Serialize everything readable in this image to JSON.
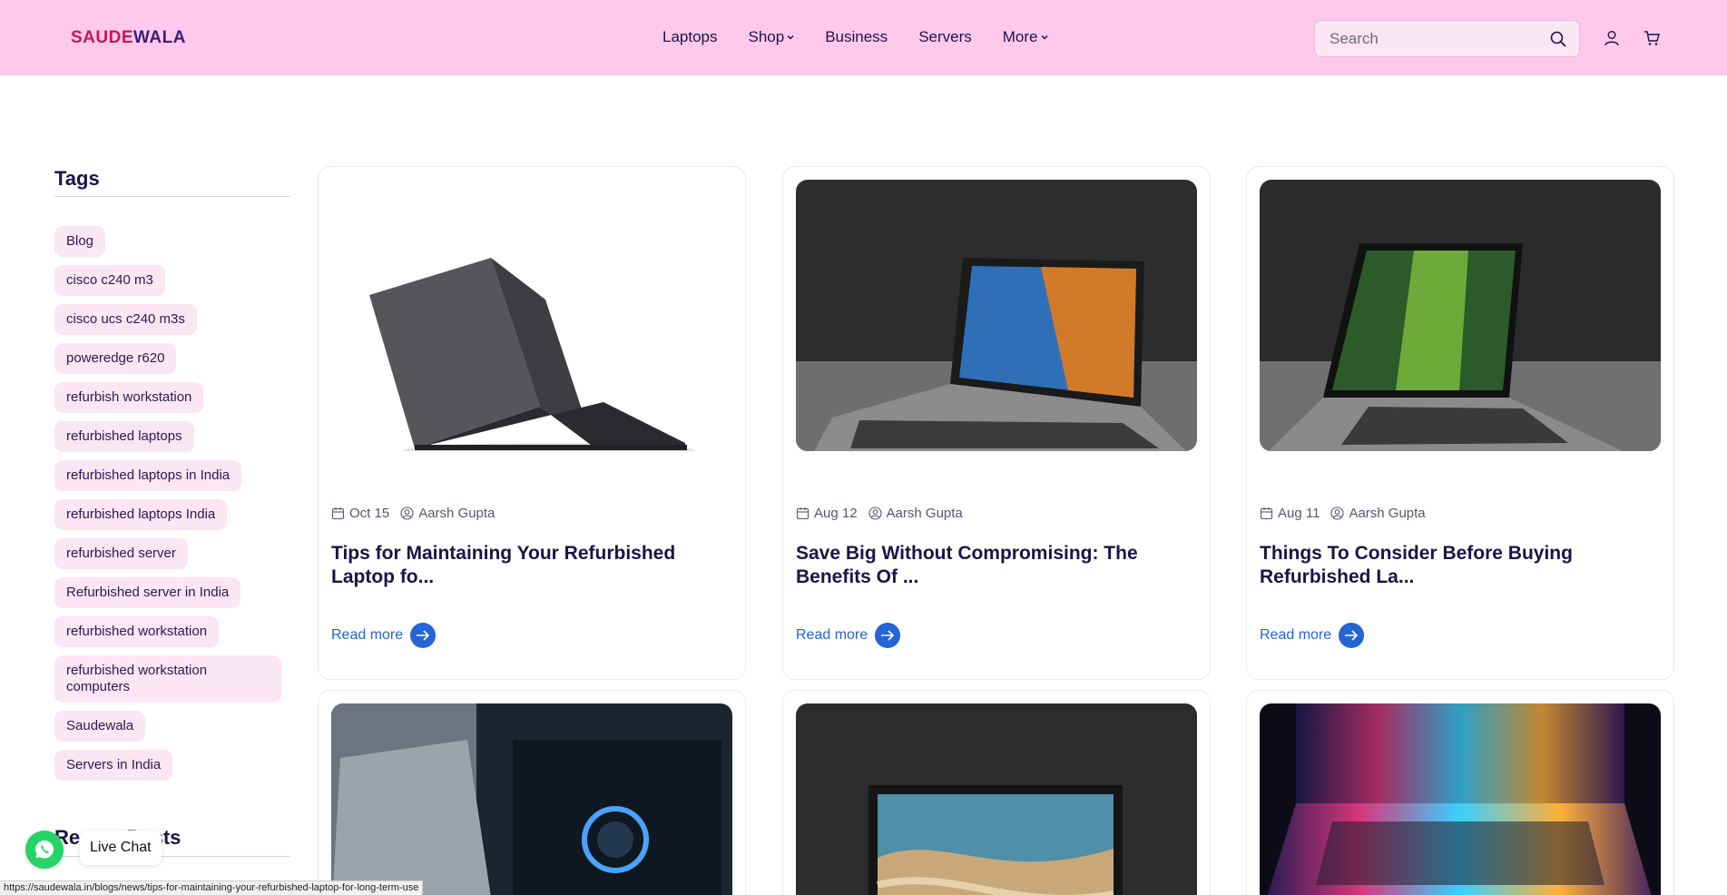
{
  "header": {
    "logo": {
      "part1": "SAUDE",
      "part2": "WALA"
    },
    "nav": [
      {
        "label": "Laptops",
        "dropdown": false
      },
      {
        "label": "Shop",
        "dropdown": true
      },
      {
        "label": "Business",
        "dropdown": false
      },
      {
        "label": "Servers",
        "dropdown": false
      },
      {
        "label": "More",
        "dropdown": true
      }
    ],
    "search": {
      "placeholder": "Search",
      "icon": "search-icon"
    },
    "icons": [
      "account-icon",
      "cart-icon"
    ]
  },
  "sidebar": {
    "tags_title": "Tags",
    "tags": [
      "Blog",
      "cisco c240 m3",
      "cisco ucs c240 m3s",
      "poweredge r620",
      "refurbish workstation",
      "refurbished laptops",
      "refurbished laptops in India",
      "refurbished laptops India",
      "refurbished server",
      "Refurbished server in India",
      "refurbished workstation",
      "refurbished workstation computers",
      "Saudewala",
      "Servers in India"
    ],
    "recent_title": "Recent Posts"
  },
  "posts": [
    {
      "date": "Oct 15",
      "author": "Aarsh Gupta",
      "title": "Tips for Maintaining Your Refurbished Laptop fo...",
      "read_more": "Read more"
    },
    {
      "date": "Aug 12",
      "author": "Aarsh Gupta",
      "title": "Save Big Without Compromising: The Benefits Of ...",
      "read_more": "Read more"
    },
    {
      "date": "Aug 11",
      "author": "Aarsh Gupta",
      "title": "Things To Consider Before Buying Refurbished La...",
      "read_more": "Read more"
    }
  ],
  "live_chat": {
    "label": "Live Chat",
    "icon": "whatsapp-icon"
  },
  "status_bar": {
    "url": "https://saudewala.in/blogs/news/tips-for-maintaining-your-refurbished-laptop-for-long-term-use"
  },
  "colors": {
    "header_bg": "#ffc9ec",
    "tag_bg": "#fbe6f3",
    "link": "#2563d6",
    "text": "#1d1346"
  }
}
